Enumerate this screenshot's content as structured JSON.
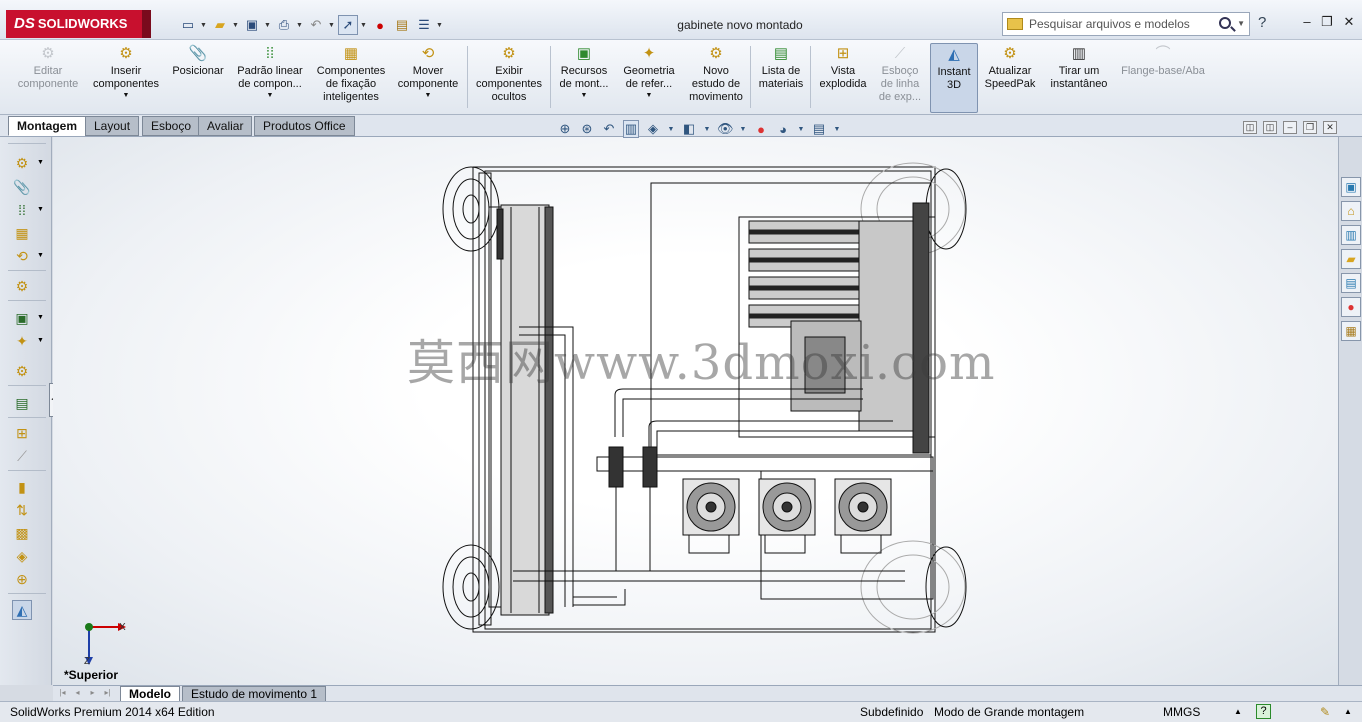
{
  "titlebar": {
    "brand": "SOLIDWORKS",
    "brand_mark": "DS",
    "document_title": "gabinete novo montado",
    "search_placeholder": "Pesquisar arquivos e modelos",
    "help": "?",
    "window_controls": {
      "minimize": "–",
      "restore": "❐",
      "close": "✕"
    }
  },
  "quick_access": [
    "new-icon",
    "open-icon",
    "save-icon",
    "print-icon",
    "undo-icon",
    "select-icon",
    "rebuild-icon",
    "file-properties-icon",
    "options-icon"
  ],
  "commands": [
    {
      "label": "Editar\ncomponente",
      "icon": "edit-component-icon",
      "disabled": true
    },
    {
      "label": "Inserir\ncomponentes",
      "icon": "insert-components-icon",
      "disabled": false,
      "dropdown": true
    },
    {
      "label": "Posicionar",
      "icon": "mate-icon",
      "disabled": false
    },
    {
      "label": "Padrão linear\nde compon...",
      "icon": "linear-pattern-icon",
      "disabled": false,
      "dropdown": true
    },
    {
      "label": "Componentes\nde fixação\ninteligentes",
      "icon": "smart-fasteners-icon",
      "disabled": false
    },
    {
      "label": "Mover\ncomponente",
      "icon": "move-component-icon",
      "disabled": false,
      "dropdown": true
    },
    {
      "label": "Exibir\ncomponentes\nocultos",
      "icon": "show-hidden-icon",
      "disabled": false
    },
    {
      "label": "Recursos\nde mont...",
      "icon": "assembly-features-icon",
      "disabled": false,
      "dropdown": true
    },
    {
      "label": "Geometria\nde refer...",
      "icon": "reference-geometry-icon",
      "disabled": false,
      "dropdown": true
    },
    {
      "label": "Novo\nestudo de\nmovimento",
      "icon": "motion-study-icon",
      "disabled": false
    },
    {
      "label": "Lista de\nmateriais",
      "icon": "bill-of-materials-icon",
      "disabled": false
    },
    {
      "label": "Vista\nexplodida",
      "icon": "exploded-view-icon",
      "disabled": false
    },
    {
      "label": "Esboço\nde linha\nde exp...",
      "icon": "explode-line-icon",
      "disabled": true
    },
    {
      "label": "Instant\n3D",
      "icon": "instant3d-icon",
      "disabled": false,
      "active": true
    },
    {
      "label": "Atualizar\nSpeedPak",
      "icon": "speedpak-icon",
      "disabled": false
    },
    {
      "label": "Tirar um\ninstantâneo",
      "icon": "snapshot-icon",
      "disabled": false
    },
    {
      "label": "Flange-base/Aba",
      "icon": "base-flange-icon",
      "disabled": true
    }
  ],
  "tabs": [
    {
      "label": "Montagem",
      "active": true
    },
    {
      "label": "Layout",
      "active": false
    },
    {
      "label": "Esboço",
      "active": false
    },
    {
      "label": "Avaliar",
      "active": false
    },
    {
      "label": "Produtos Office",
      "active": false
    }
  ],
  "bottom_tabs": [
    {
      "label": "Modelo",
      "active": true
    },
    {
      "label": "Estudo de movimento 1",
      "active": false
    }
  ],
  "viewport": {
    "watermark": "莫西网www.3dmoxi.com",
    "triad_axes": {
      "x": "X",
      "z": "Z"
    },
    "view_label": "*Superior"
  },
  "statusbar": {
    "edition": "SolidWorks Premium 2014 x64 Edition",
    "definition": "Subdefinido",
    "mode": "Modo de Grande montagem",
    "units": "MMGS",
    "help_icon": "?"
  },
  "colors": {
    "brand_red": "#c8102e",
    "accent_blue": "#30567f"
  }
}
